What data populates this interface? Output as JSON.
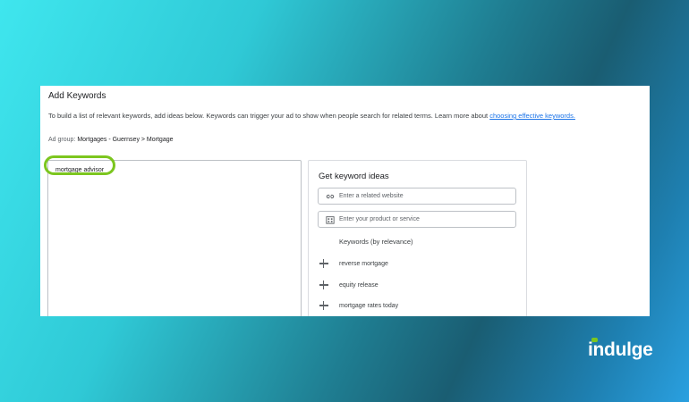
{
  "dialog": {
    "title": "Add Keywords",
    "description": "To build a list of relevant keywords, add ideas below. Keywords can trigger your ad to show when people search for related terms. Learn more about ",
    "learn_more_link": "choosing effective keywords.",
    "ad_group_label": "Ad group: ",
    "ad_group_value": "Mortgages - Guernsey > Mortgage"
  },
  "keyword_input": {
    "value": "mortgage advisor"
  },
  "ideas": {
    "title": "Get keyword ideas",
    "website_placeholder": "Enter a related website",
    "product_placeholder": "Enter your product or service",
    "list_header": "Keywords (by relevance)",
    "items": [
      {
        "label": "reverse mortgage"
      },
      {
        "label": "equity release"
      },
      {
        "label": "mortgage rates today"
      }
    ]
  },
  "brand": {
    "logo_text": "indulge",
    "accent_color": "#7cc61f"
  }
}
